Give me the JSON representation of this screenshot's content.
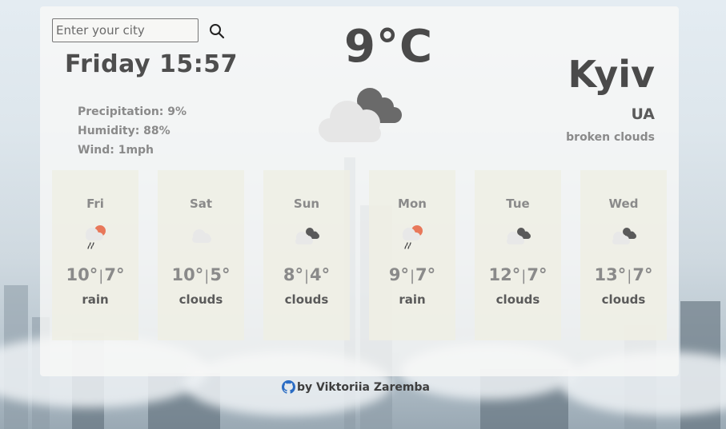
{
  "search": {
    "placeholder": "Enter your city"
  },
  "current": {
    "datetime": "Friday 15:57",
    "precipitation": "Precipitation: 9%",
    "humidity": "Humidity: 88%",
    "wind": "Wind: 1mph",
    "temperature": "9°C",
    "icon": "broken-clouds-icon",
    "city": "Kyiv",
    "country": "UA",
    "description": "broken clouds"
  },
  "forecast": [
    {
      "day": "Fri",
      "max": "10°",
      "min": "7°",
      "desc": "rain",
      "icon": "rain-icon"
    },
    {
      "day": "Sat",
      "max": "10°",
      "min": "5°",
      "desc": "clouds",
      "icon": "clouds-icon"
    },
    {
      "day": "Sun",
      "max": "8°",
      "min": "4°",
      "desc": "clouds",
      "icon": "broken-clouds-icon"
    },
    {
      "day": "Mon",
      "max": "9°",
      "min": "7°",
      "desc": "rain",
      "icon": "rain-icon"
    },
    {
      "day": "Tue",
      "max": "12°",
      "min": "7°",
      "desc": "clouds",
      "icon": "broken-clouds-icon"
    },
    {
      "day": "Wed",
      "max": "13°",
      "min": "7°",
      "desc": "clouds",
      "icon": "broken-clouds-icon"
    }
  ],
  "footer": {
    "text": "by Viktoriia Zaremba",
    "icon": "github-icon"
  },
  "colors": {
    "sun": "#e8785a",
    "cloud_dark": "#6a6a6a",
    "cloud_light": "#e8e8e8",
    "text_dark": "#4a4a4a",
    "text_muted": "#8a8a8a"
  }
}
